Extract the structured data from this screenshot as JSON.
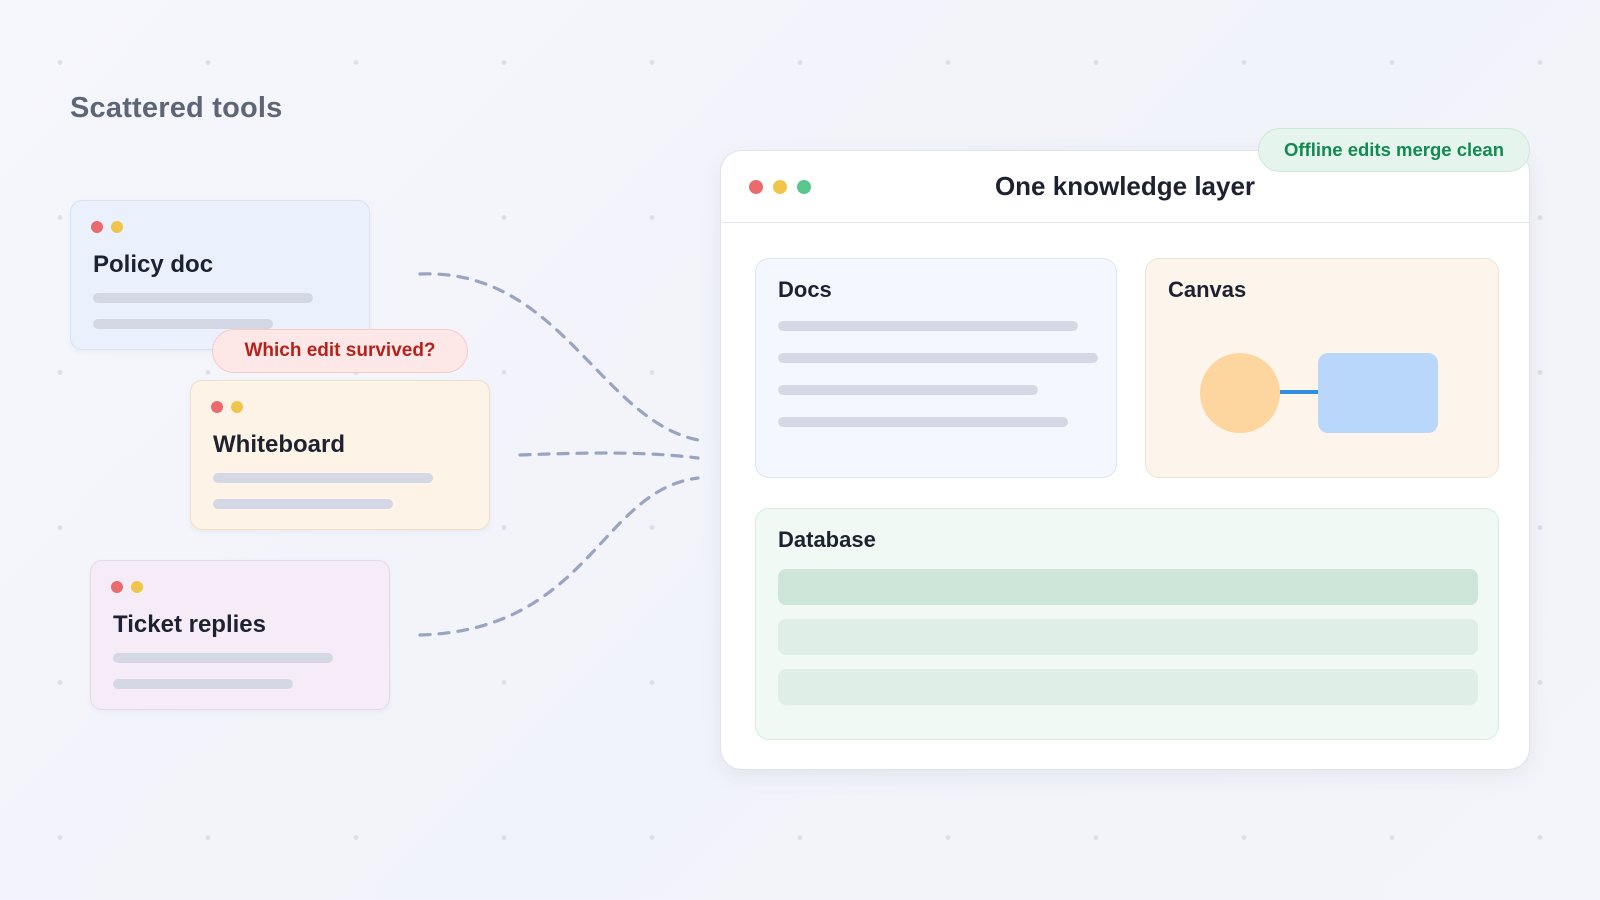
{
  "heading": "Scattered tools",
  "tools": [
    {
      "title": "Policy doc"
    },
    {
      "title": "Whiteboard"
    },
    {
      "title": "Ticket replies"
    }
  ],
  "conflict_badge": "Which edit survived?",
  "panel": {
    "title": "One knowledge layer",
    "badge": "Offline edits merge clean",
    "sections": {
      "docs": "Docs",
      "canvas": "Canvas",
      "database": "Database"
    }
  },
  "colors": {
    "window_red": "#ea6a6e",
    "window_yellow": "#efc64a",
    "window_green": "#58c78e",
    "conflict_text": "#b5231e",
    "merge_text": "#128a52",
    "connector": "#9aa3c0"
  }
}
